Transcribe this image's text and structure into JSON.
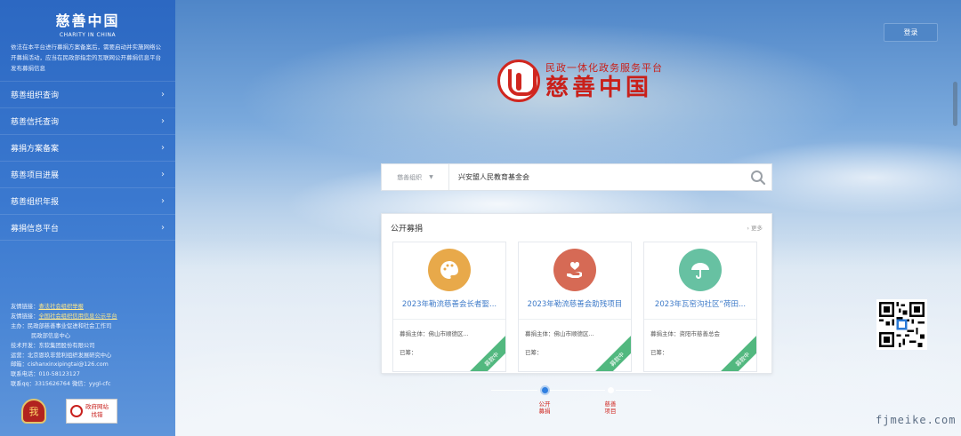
{
  "sidebar": {
    "title": "慈善中国",
    "subtitle": "CHARITY IN CHINA",
    "description": "依法在本平台进行募捐方案备案后，需要启动并实施网络公开募捐活动，应当在民政部指定的互联网公开募捐信息平台发布募捐信息",
    "nav": [
      {
        "label": "慈善组织查询"
      },
      {
        "label": "慈善信托查询"
      },
      {
        "label": "募捐方案备案"
      },
      {
        "label": "慈善项目进展"
      },
      {
        "label": "慈善组织年报"
      },
      {
        "label": "募捐信息平台"
      }
    ],
    "footer": {
      "link1_prefix": "友情链接：",
      "link1_text": "查法社会组织举报",
      "link2_prefix": "友情链接：",
      "link2_text": "全国社会组织信用信息公示平台",
      "host_line1": "主办：民政部慈善事业促进和社会工作司",
      "host_line2": "民政部信息中心",
      "tech": "技术开发：东软集团股份有限公司",
      "ops": "运营：北京恩玖非营利组织发展研究中心",
      "email": "邮箱：cishanxinxipingtai@126.com",
      "phone": "联系电话：010-58123127",
      "qq": "联系qq：3315626764  微信：yygl-cfc"
    },
    "badge_shield_text": "我",
    "badge_gov_line1": "政府网站",
    "badge_gov_line2": "找错"
  },
  "header": {
    "login_label": "登录",
    "logo_line1": "民政一体化政务服务平台",
    "logo_line2": "慈善中国"
  },
  "search": {
    "category": "慈善组织",
    "value": "兴安盟人民教育基金会"
  },
  "panel": {
    "title": "公开募捐",
    "more": "› 更多",
    "cards": [
      {
        "name": "2023年勒流慈善会长者娶...",
        "sponsor": "募捐主体：佛山市顺德区...",
        "raised": "已筹：",
        "status": "募款中",
        "icon": "palette-icon",
        "color": "#e8a94a"
      },
      {
        "name": "2023年勒流慈善会助残项目",
        "sponsor": "募捐主体：佛山市顺德区...",
        "raised": "已筹：",
        "status": "募款中",
        "icon": "heart-hand-icon",
        "color": "#d66a55"
      },
      {
        "name": "2023年瓦窑沟社区“荷田...",
        "sponsor": "募捐主体：资阳市慈善总会",
        "raised": "已筹：",
        "status": "募款中",
        "icon": "umbrella-icon",
        "color": "#67c1a2"
      }
    ]
  },
  "timeline": {
    "items": [
      {
        "label_line1": "公开",
        "label_line2": "募捐"
      },
      {
        "label_line1": "慈善",
        "label_line2": "项目"
      }
    ]
  },
  "watermark": "fjmeike.com",
  "colors": {
    "sidebar_blue": "#3a78cf",
    "brand_red": "#c9201a",
    "link_blue": "#3f7bc9",
    "status_green": "#52b87f"
  }
}
